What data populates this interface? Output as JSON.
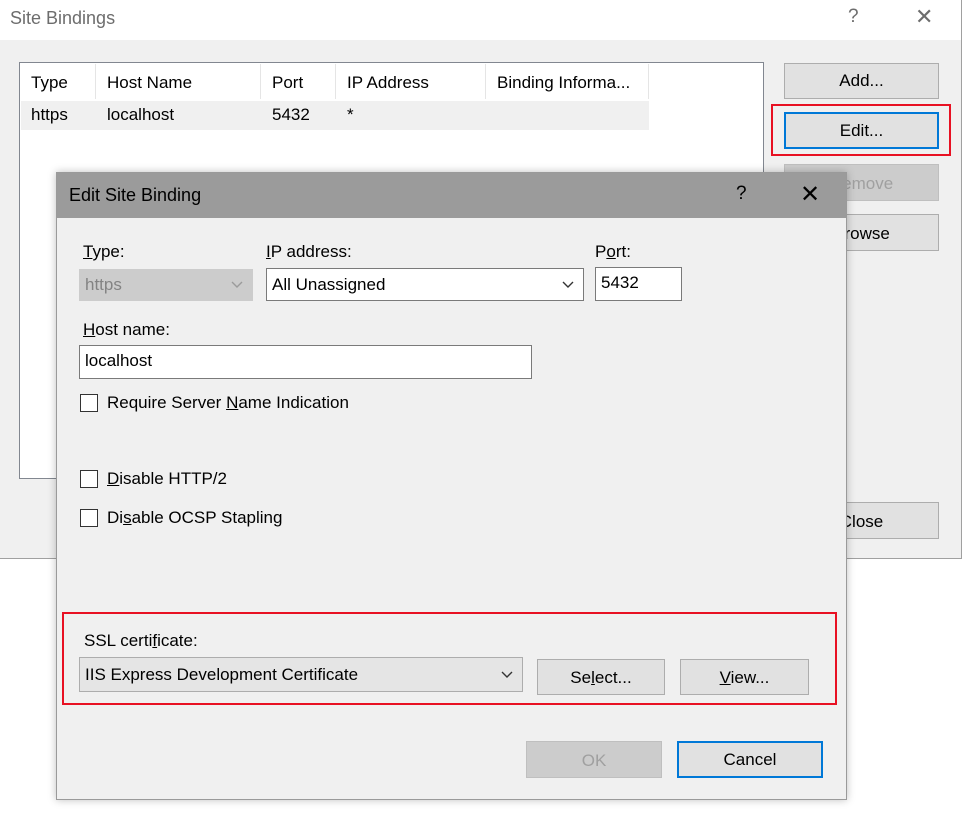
{
  "outer": {
    "title": "Site Bindings",
    "help": "?",
    "close": "✕",
    "columns": [
      "Type",
      "Host Name",
      "Port",
      "IP Address",
      "Binding Informa..."
    ],
    "rows": [
      {
        "type": "https",
        "host": "localhost",
        "port": "5432",
        "ip": "*",
        "info": ""
      }
    ],
    "buttons": {
      "add": "Add...",
      "edit": "Edit...",
      "remove": "Remove",
      "browse": "Browse",
      "close": "Close"
    }
  },
  "inner": {
    "title": "Edit Site Binding",
    "help": "?",
    "close": "✕",
    "type": {
      "label_key": "T",
      "label_rest": "ype:",
      "value": "https"
    },
    "ip": {
      "label_key": "I",
      "label_rest": "P address:",
      "value": "All Unassigned"
    },
    "port": {
      "label_pre": "P",
      "label_key": "o",
      "label_rest": "rt:",
      "value": "5432"
    },
    "host": {
      "label_key": "H",
      "label_rest": "ost name:",
      "value": "localhost"
    },
    "sni": {
      "pre": "Require Server ",
      "key": "N",
      "rest": "ame Indication",
      "checked": false
    },
    "http2": {
      "key": "D",
      "rest": "isable HTTP/2",
      "checked": false
    },
    "ocsp": {
      "pre": "Di",
      "key": "s",
      "rest": "able OCSP Stapling",
      "checked": false
    },
    "ssl": {
      "label_pre": "SSL certi",
      "label_key": "f",
      "label_rest": "icate:",
      "value": "IIS Express Development Certificate",
      "select": {
        "pre": "Se",
        "key": "l",
        "rest": "ect..."
      },
      "view": {
        "key": "V",
        "rest": "iew..."
      }
    },
    "ok": "OK",
    "cancel": "Cancel"
  },
  "colors": {
    "accent": "#0078d7",
    "highlight": "#e81123",
    "dialog_bg": "#f0f0f0",
    "titlebar_inactive": "#9b9b9b"
  }
}
